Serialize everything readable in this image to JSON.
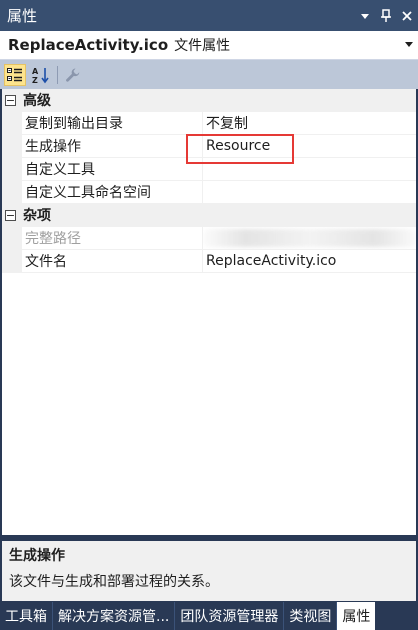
{
  "panel": {
    "title": "属性",
    "dropdown_glyph": "▾",
    "pin_glyph": "⊥",
    "close_glyph": "✕"
  },
  "selector": {
    "object_name": "ReplaceActivity.ico",
    "object_type": "文件属性"
  },
  "toolbar": {
    "categorized_icon": "categorized-icon",
    "alphabetical_icon": "alphabetical-icon",
    "property_pages_icon": "wrench-icon"
  },
  "grid": {
    "categories": [
      {
        "label": "高级",
        "expanded": true,
        "properties": [
          {
            "name": "复制到输出目录",
            "value": "不复制"
          },
          {
            "name": "生成操作",
            "value": "Resource"
          },
          {
            "name": "自定义工具",
            "value": ""
          },
          {
            "name": "自定义工具命名空间",
            "value": ""
          }
        ]
      },
      {
        "label": "杂项",
        "expanded": true,
        "properties": [
          {
            "name": "完整路径",
            "value": ""
          },
          {
            "name": "文件名",
            "value": "ReplaceActivity.ico"
          }
        ]
      }
    ]
  },
  "description": {
    "title": "生成操作",
    "text": "该文件与生成和部署过程的关系。"
  },
  "tabs": [
    "工具箱",
    "解决方案资源管...",
    "团队资源管理器",
    "类视图",
    "属性"
  ],
  "colors": {
    "frame": "#293955",
    "titlebar": "#384f70",
    "toolbar": "#bcc7d8",
    "highlight": "#e53935",
    "active_tool": "#fde48d"
  }
}
